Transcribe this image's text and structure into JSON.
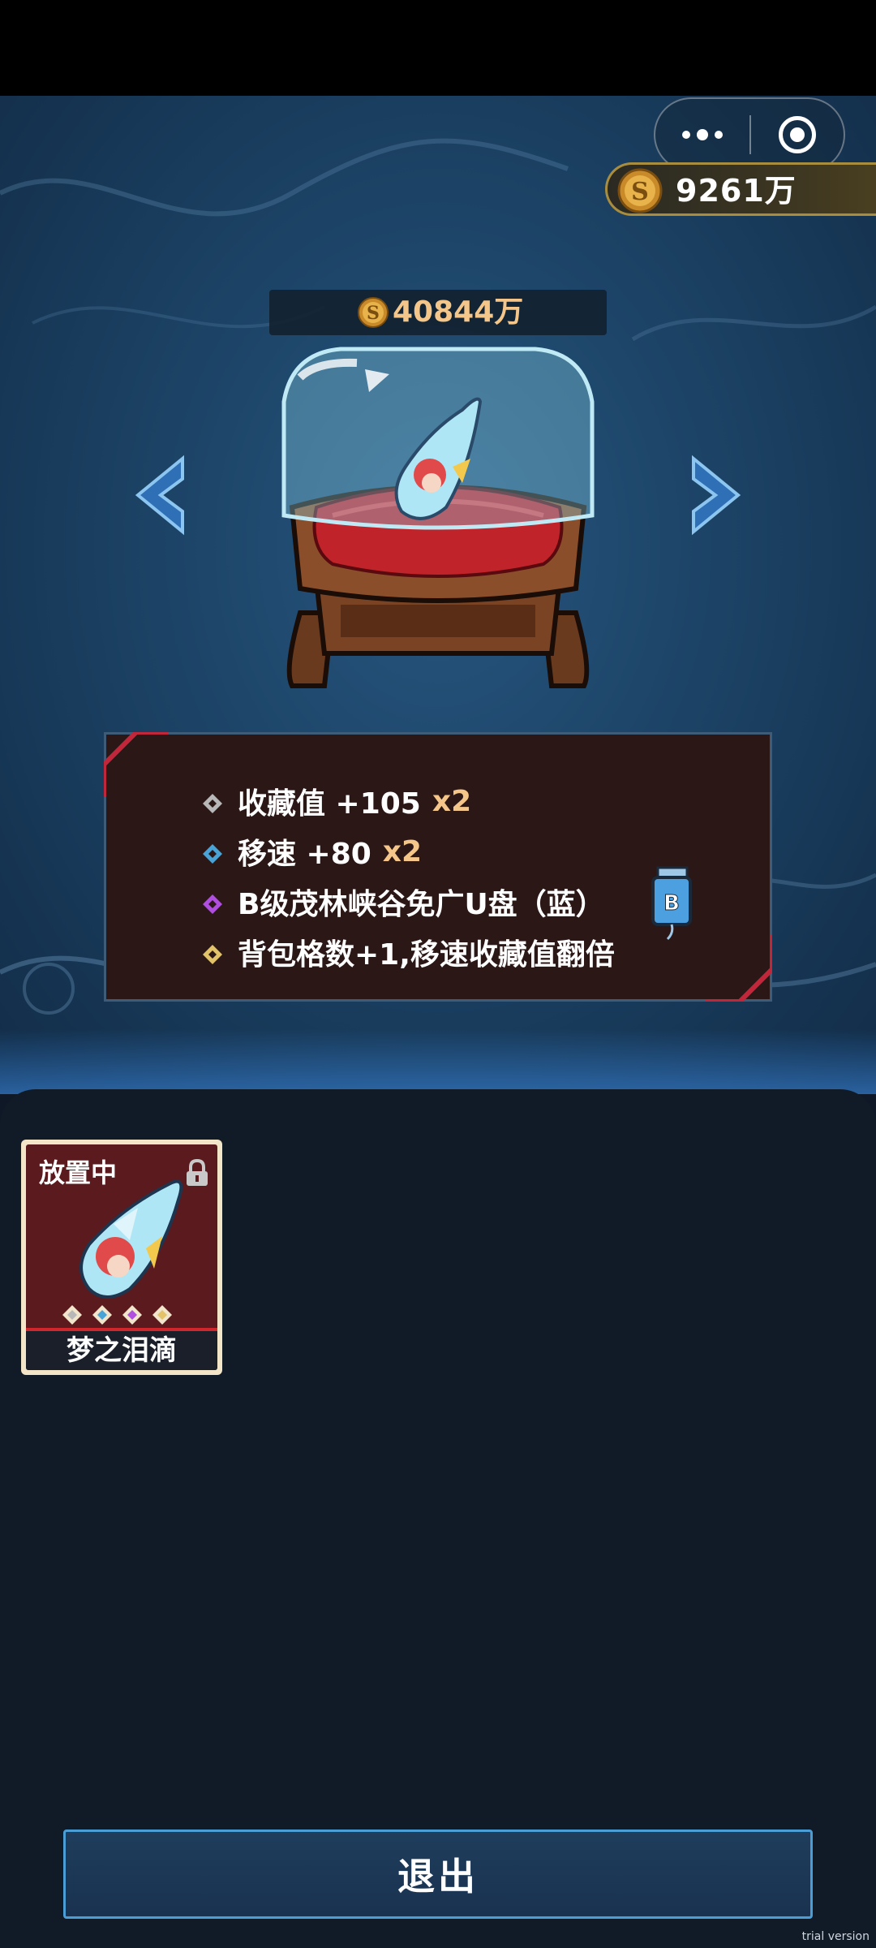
{
  "top_bar": {
    "coin_balance": "9261万"
  },
  "showcase": {
    "price": "40844万"
  },
  "info": {
    "lines": [
      {
        "text": "收藏值 +105",
        "multiplier": "x2",
        "diamond_color": "#b8b8b8"
      },
      {
        "text": "移速 +80",
        "multiplier": "x2",
        "diamond_color": "#4aa3d6"
      },
      {
        "text": "B级茂林峡谷免广U盘（蓝）",
        "multiplier": "",
        "diamond_color": "#b04ee0"
      },
      {
        "text": "背包格数+1,移速收藏值翻倍",
        "multiplier": "",
        "diamond_color": "#e2c36a"
      }
    ],
    "usb_badge_letter": "B"
  },
  "inventory": {
    "items": [
      {
        "status": "放置中",
        "name": "梦之泪滴",
        "locked": true
      }
    ]
  },
  "footer": {
    "exit_label": "退出"
  },
  "watermark": "trial version",
  "colors": {
    "accent_gold": "#f4c68a",
    "exit_border": "#4b9dd6",
    "panel_bg": "#2a1716"
  },
  "icons": {
    "more": "more-dots-icon",
    "close": "target-close-icon",
    "coin": "coin-icon",
    "lock": "lock-icon",
    "arrow_left": "chevron-left-icon",
    "arrow_right": "chevron-right-icon"
  }
}
